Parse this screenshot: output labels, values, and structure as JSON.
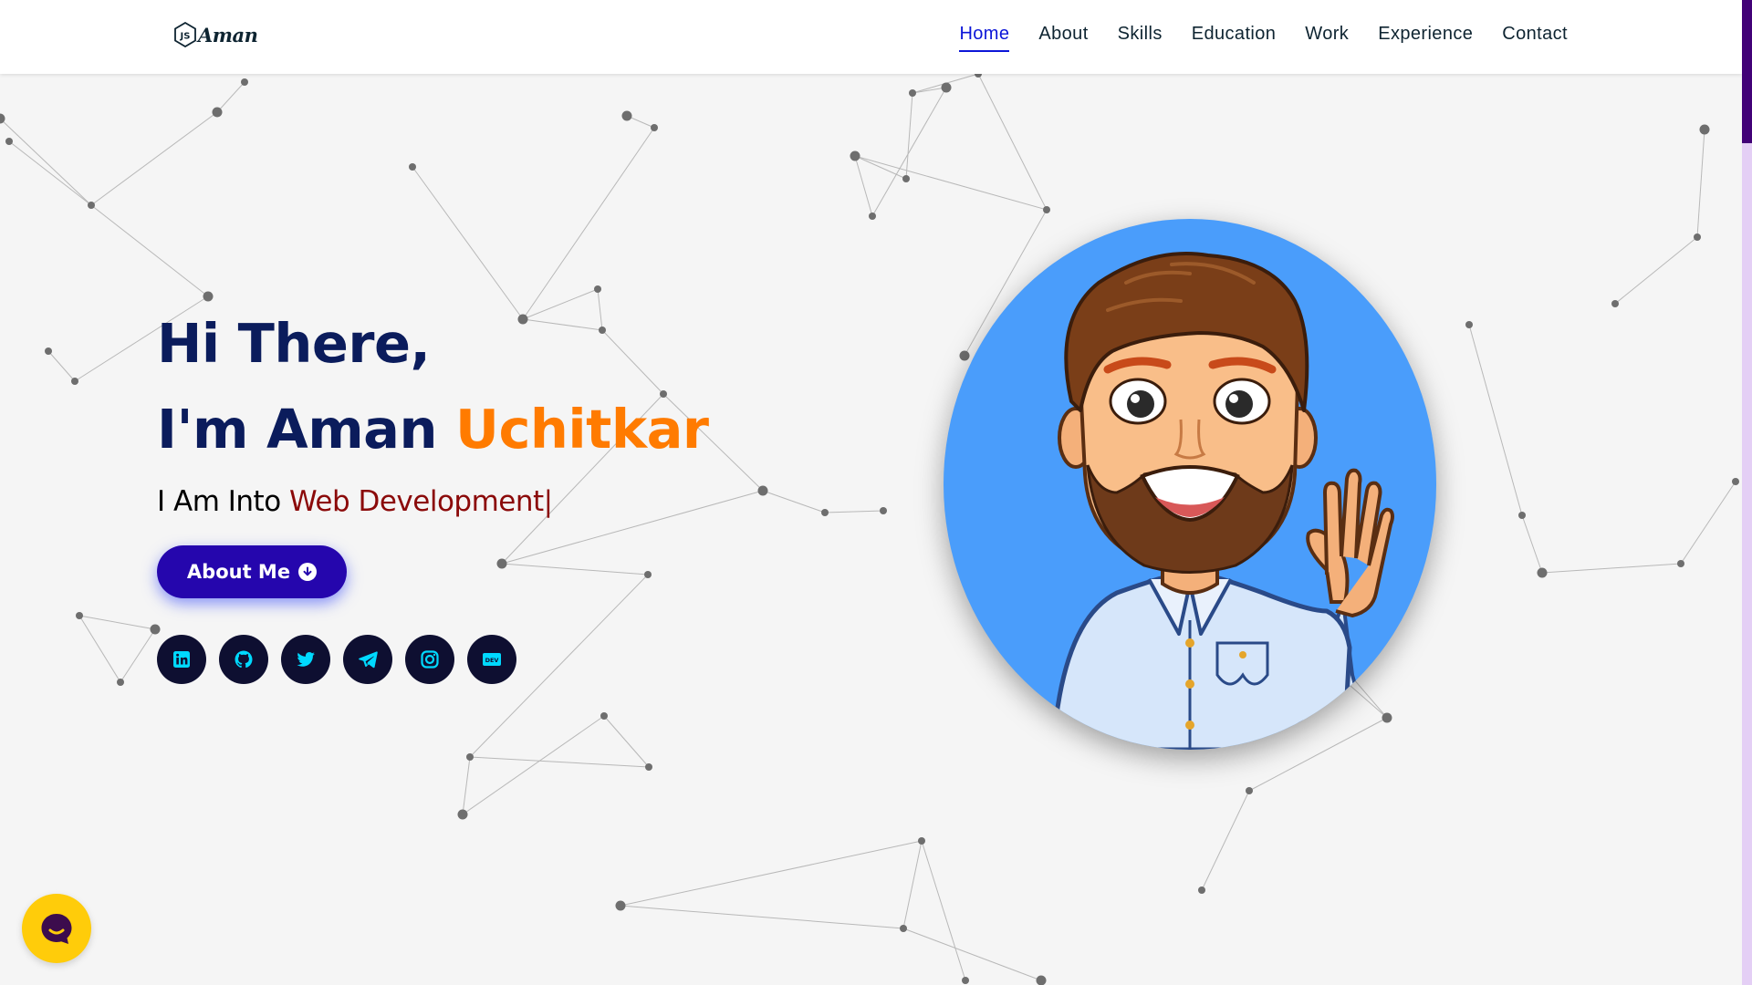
{
  "brand": {
    "icon": "js-hexagon-icon",
    "text": "Aman"
  },
  "nav": {
    "items": [
      {
        "label": "Home",
        "active": true
      },
      {
        "label": "About",
        "active": false
      },
      {
        "label": "Skills",
        "active": false
      },
      {
        "label": "Education",
        "active": false
      },
      {
        "label": "Work",
        "active": false
      },
      {
        "label": "Experience",
        "active": false
      },
      {
        "label": "Contact",
        "active": false
      }
    ]
  },
  "hero": {
    "greeting": "Hi There,",
    "name_prefix": "I'm Aman ",
    "name_highlight": "Uchitkar",
    "sub_prefix": "I Am Into ",
    "sub_typed": "Web Development|",
    "button_label": "About Me",
    "button_icon": "arrow-circle-down-icon"
  },
  "socials": [
    {
      "name": "linkedin",
      "icon": "linkedin-icon"
    },
    {
      "name": "github",
      "icon": "github-icon"
    },
    {
      "name": "twitter",
      "icon": "twitter-icon"
    },
    {
      "name": "telegram",
      "icon": "telegram-icon"
    },
    {
      "name": "instagram",
      "icon": "instagram-icon"
    },
    {
      "name": "dev",
      "icon": "dev-icon",
      "text": "DEV"
    }
  ],
  "avatar": {
    "icon": "waving-man-avatar"
  },
  "chat": {
    "icon": "chat-bubble-icon"
  },
  "colors": {
    "heading": "#0b1c5c",
    "accent_orange": "#ff7b00",
    "typed_red": "#8b0a0a",
    "button": "#2506ad",
    "nav_active": "#0c16d8",
    "social_bg": "#0e0f31",
    "social_icon": "#00d9ff",
    "avatar_bg": "#4a9dfb",
    "chat_bg": "#ffcc0a",
    "scroll_thumb": "#420177",
    "scroll_track": "#e4cff5"
  }
}
